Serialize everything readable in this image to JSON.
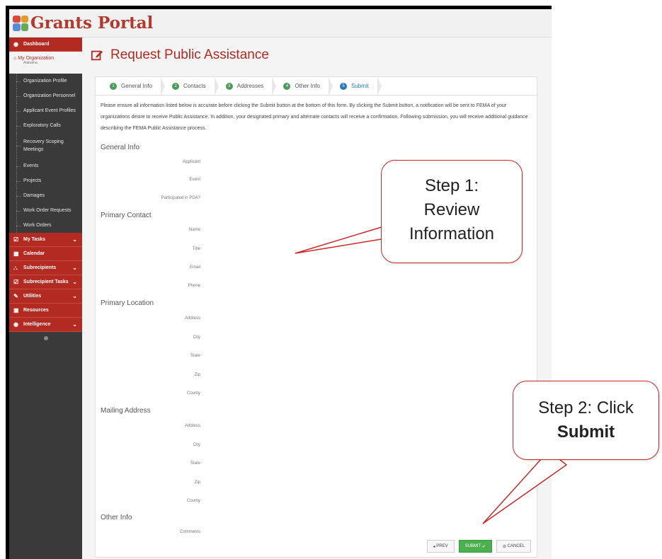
{
  "app": {
    "logo_text": "Grants Portal",
    "page_title": "Request Public Assistance"
  },
  "sidebar": {
    "dashboard": "Dashboard",
    "my_org": "My Organization",
    "my_org_sub": "Alabama",
    "links": [
      "Organization Profile",
      "Organization Personnel",
      "Applicant Event Profiles",
      "Exploratory Calls",
      "Recovery Scoping Meetings",
      "Events",
      "Projects",
      "Damages",
      "Work Order Requests",
      "Work Orders"
    ],
    "menus": [
      "My Tasks",
      "Calendar",
      "Subrecipients",
      "Subrecipient Tasks",
      "Utilities",
      "Resources",
      "Intelligence"
    ]
  },
  "steps": [
    {
      "num": "1",
      "label": "General Info"
    },
    {
      "num": "2",
      "label": "Contacts"
    },
    {
      "num": "3",
      "label": "Addresses"
    },
    {
      "num": "4",
      "label": "Other Info"
    },
    {
      "num": "5",
      "label": "Submit"
    }
  ],
  "intro": "Please ensure all information listed below is accurate before clicking the Submit button at the bottom of this form. By clicking the Submit button, a notification will be sent to FEMA of your organizations desire to receive Public Assistance. In addition, your designated primary and alternate contacts will receive a confirmation. Following submission, you will receive additional guidance describing the FEMA Public Assistance process.",
  "sections": {
    "general": "General Info",
    "primary_contact": "Primary Contact",
    "primary_location": "Primary Location",
    "mailing": "Mailing Address",
    "other": "Other Info"
  },
  "fields": {
    "applicant": "Applicant",
    "event": "Event",
    "pda": "Participated in PDA?",
    "name": "Name",
    "title": "Title",
    "email": "Email",
    "phone": "Phone",
    "address": "Address",
    "city": "City",
    "state": "State",
    "zip": "Zip",
    "county": "County",
    "comments": "Comments"
  },
  "buttons": {
    "prev": "PREV",
    "submit": "SUBMIT",
    "cancel": "CANCEL"
  },
  "callouts": {
    "step1_line1": "Step 1:",
    "step1_line2": "Review",
    "step1_line3": "Information",
    "step2_line1": "Step 2: Click",
    "step2_line2": "Submit"
  },
  "colors": {
    "brand": "#b22a22",
    "sidebar": "#3a3a3a",
    "step_done": "#4a9a5a",
    "step_active": "#2a76b8",
    "submit": "#4caf50"
  }
}
